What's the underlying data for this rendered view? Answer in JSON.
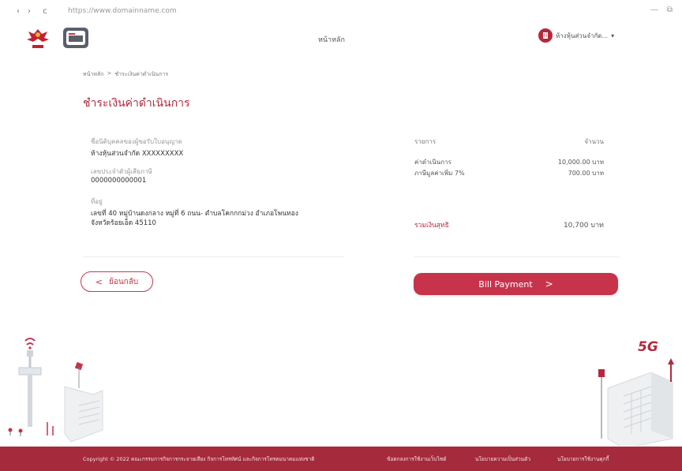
{
  "browser": {
    "back_glyph": "‹",
    "forward_glyph": "›",
    "reload_glyph": "c",
    "url": "https://www.domainname.com",
    "minimize_glyph": "—",
    "restore_glyph": "⧉"
  },
  "header": {
    "nav_home": "หน้าหลัก",
    "user_name": "ห้างหุ้นส่วนจำกัด...",
    "caret": "▾"
  },
  "breadcrumb": [
    "หน้าหลัก",
    ">",
    "ชำระเงินค่าดำเนินการ"
  ],
  "page_title": "ชำระเงินค่าดำเนินการ",
  "details": {
    "company_label": "ชื่อนิติบุคคลของผู้ขอรับใบอนุญาต",
    "company_value": "ห้างหุ้นส่วนจำกัด XXXXXXXXX",
    "taxid_label": "เลขประจำตัวผู้เสียภาษี",
    "taxid_value": "0000000000001",
    "address_label": "ที่อยู่",
    "address_line1": "เลขที่ 40 หมู่บ้านดงกลาง หมู่ที่ 6 ถนน- ตำบลโคกกกม่วง อำเภอโพนทอง",
    "address_line2": "จังหวัดร้อยเอ็ด 45110"
  },
  "summary": {
    "col_item": "รายการ",
    "col_amount": "จำนวน",
    "rows": [
      {
        "label": "ค่าดำเนินการ",
        "value": "10,000.00 บาท"
      },
      {
        "label": "ภาษีมูลค่าเพิ่ม 7%",
        "value": "700.00 บาท"
      }
    ],
    "net_label": "รวมเงินสุทธิ",
    "net_value": "10,700 บาท"
  },
  "actions": {
    "back_label": "ย้อนกลับ",
    "back_glyph": "<",
    "pay_label": "Bill Payment",
    "pay_glyph": ">"
  },
  "illustration": {
    "tower_text": "5G"
  },
  "footer": {
    "copyright": "Copyright © 2022 คณะกรรมการกิจการกระจายเสียง กิจการโทรทัศน์ และกิจการโทรคมนาคมแห่งชาติ",
    "links": [
      "ข้อตกลงการใช้งานเว็บไซต์",
      "นโยบายความเป็นส่วนตัว",
      "นโยบายการใช้งานคุกกี้"
    ]
  },
  "colors": {
    "brand": "#c7334a",
    "footer_bg": "#a52a3c"
  }
}
